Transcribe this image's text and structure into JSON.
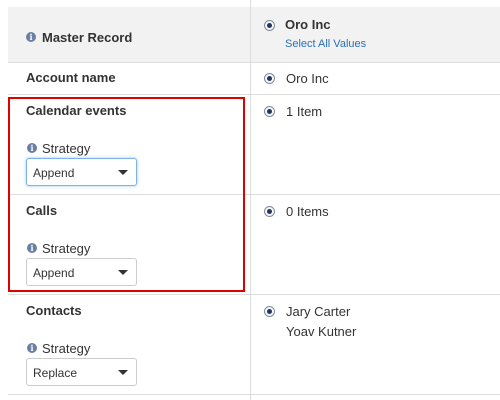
{
  "header": {
    "master_record_label": "Master Record",
    "record_name": "Oro Inc",
    "select_all_label": "Select All Values"
  },
  "rows": [
    {
      "field": "Account name",
      "value": "Oro Inc"
    },
    {
      "field": "Calendar events",
      "strategy_label": "Strategy",
      "strategy_value": "Append",
      "value": "1 Item"
    },
    {
      "field": "Calls",
      "strategy_label": "Strategy",
      "strategy_value": "Append",
      "value": "0 Items"
    },
    {
      "field": "Contacts",
      "strategy_label": "Strategy",
      "strategy_value": "Replace",
      "values": [
        "Jary Carter",
        "Yoav Kutner"
      ]
    }
  ],
  "colors": {
    "highlight": "#e00000",
    "link": "#2a6fb8",
    "header_bg": "#f2f2f2"
  }
}
